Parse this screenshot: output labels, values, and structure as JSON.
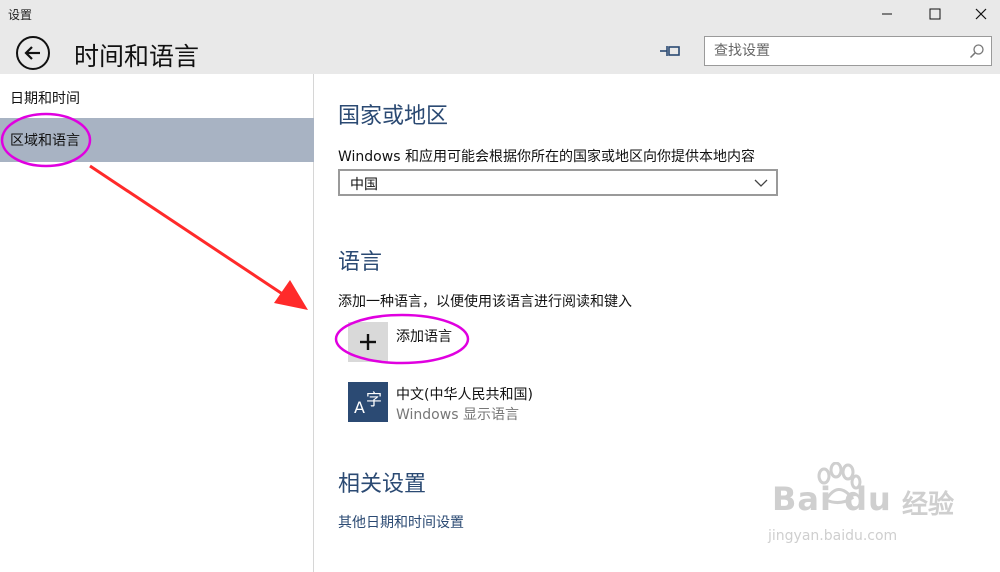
{
  "window": {
    "title": "设置"
  },
  "header": {
    "title": "时间和语言",
    "search_placeholder": "查找设置"
  },
  "sidebar": {
    "items": [
      {
        "label": "日期和时间"
      },
      {
        "label": "区域和语言"
      }
    ]
  },
  "country_region": {
    "heading": "国家或地区",
    "description": "Windows 和应用可能会根据你所在的国家或地区向你提供本地内容",
    "selected": "中国"
  },
  "language": {
    "heading": "语言",
    "description": "添加一种语言，以便使用该语言进行阅读和键入",
    "add_label": "添加语言",
    "installed": [
      {
        "name": "中文(中华人民共和国)",
        "subtitle": "Windows 显示语言",
        "tile_latin": "A",
        "tile_glyph": "字"
      }
    ]
  },
  "related": {
    "heading": "相关设置",
    "link": "其他日期和时间设置"
  },
  "watermark": {
    "brand": "Bai du",
    "cn": "经验",
    "url": "jingyan.baidu.com"
  },
  "colors": {
    "accent": "#2b4a73",
    "selected_nav": "#a8b3c3",
    "annotation": "#ff2a2a",
    "highlight_ellipse": "#e000e0"
  }
}
